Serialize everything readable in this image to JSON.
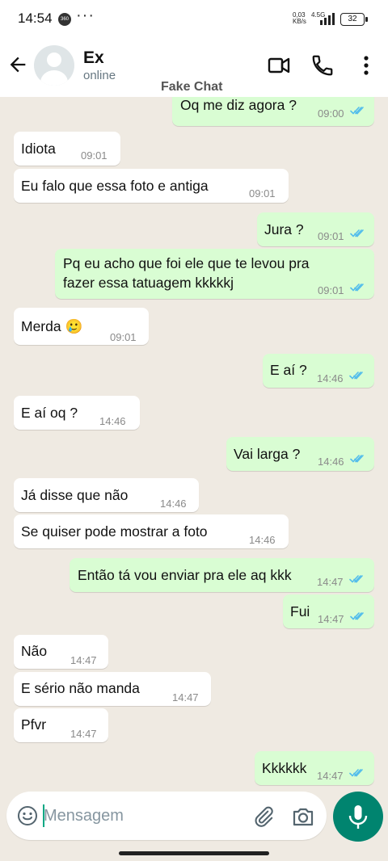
{
  "status_bar": {
    "time": "14:54",
    "net_speed_value": "0,03",
    "net_speed_unit": "KB/s",
    "network": "4.5G",
    "battery": "32"
  },
  "header": {
    "contact_name": "Ex",
    "status": "online",
    "watermark": "Fake Chat"
  },
  "messages": [
    {
      "dir": "out",
      "text": "Oq me diz agora ?",
      "time": "09:00",
      "read": true
    },
    {
      "dir": "in",
      "text": "Idiota",
      "time": "09:01"
    },
    {
      "dir": "in",
      "text": "Eu falo que essa foto e antiga",
      "time": "09:01"
    },
    {
      "dir": "out",
      "text": "Jura ?",
      "time": "09:01",
      "read": true
    },
    {
      "dir": "out",
      "text": "Pq eu acho que foi ele que te levou pra fazer essa tatuagem kkkkkj",
      "time": "09:01",
      "read": true
    },
    {
      "dir": "in",
      "text": "Merda 🥲",
      "time": "09:01"
    },
    {
      "dir": "out",
      "text": "E aí ?",
      "time": "14:46",
      "read": true
    },
    {
      "dir": "in",
      "text": "E aí oq ?",
      "time": "14:46"
    },
    {
      "dir": "out",
      "text": "Vai larga ?",
      "time": "14:46",
      "read": true
    },
    {
      "dir": "in",
      "text": "Já disse que não",
      "time": "14:46"
    },
    {
      "dir": "in",
      "text": "Se quiser pode mostrar a foto",
      "time": "14:46"
    },
    {
      "dir": "out",
      "text": "Então tá vou enviar pra ele aq kkk",
      "time": "14:47",
      "read": true
    },
    {
      "dir": "out",
      "text": "Fui",
      "time": "14:47",
      "read": true
    },
    {
      "dir": "in",
      "text": "Não",
      "time": "14:47"
    },
    {
      "dir": "in",
      "text": "E sério não manda",
      "time": "14:47"
    },
    {
      "dir": "in",
      "text": "Pfvr",
      "time": "14:47"
    },
    {
      "dir": "out",
      "text": "Kkkkkk",
      "time": "14:47",
      "read": true
    }
  ],
  "composer": {
    "placeholder": "Mensagem"
  },
  "icons": [
    "back-arrow-icon",
    "video-call-icon",
    "voice-call-icon",
    "more-options-icon",
    "scroll-down-icon",
    "emoji-icon",
    "attach-icon",
    "camera-icon",
    "mic-icon"
  ],
  "colors": {
    "incoming_bubble": "#ffffff",
    "outgoing_bubble": "#d9fdd3",
    "read_check": "#53bdeb",
    "accent": "#00846f",
    "chat_background": "#efeae2"
  }
}
